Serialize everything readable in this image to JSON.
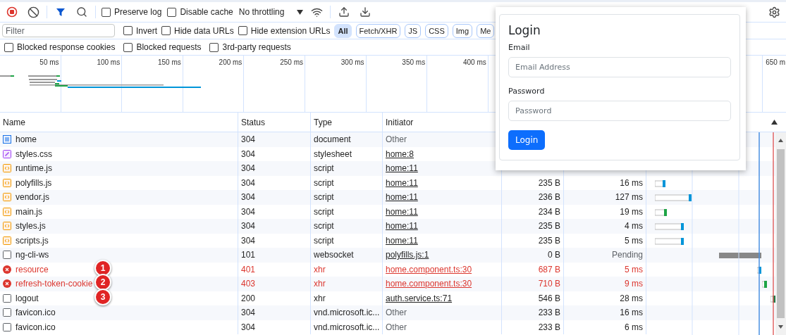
{
  "toolbar": {
    "checkboxes": [
      {
        "label": "Preserve log",
        "checked": false
      },
      {
        "label": "Disable cache",
        "checked": false
      }
    ],
    "throttling": "No throttling"
  },
  "filter_bar": {
    "placeholder": "Filter",
    "checkboxes": [
      {
        "label": "Invert",
        "checked": false
      },
      {
        "label": "Hide data URLs",
        "checked": false
      },
      {
        "label": "Hide extension URLs",
        "checked": false
      }
    ],
    "type_chips": [
      {
        "label": "All",
        "selected": true
      },
      {
        "label": "Fetch/XHR",
        "selected": false
      },
      {
        "label": "JS",
        "selected": false
      },
      {
        "label": "CSS",
        "selected": false
      },
      {
        "label": "Img",
        "selected": false
      },
      {
        "label": "Me",
        "selected": false
      }
    ]
  },
  "options_row": [
    {
      "label": "Blocked response cookies",
      "checked": false
    },
    {
      "label": "Blocked requests",
      "checked": false
    },
    {
      "label": "3rd-party requests",
      "checked": false
    }
  ],
  "overview": {
    "ticks": [
      "50 ms",
      "100 ms",
      "150 ms",
      "200 ms",
      "250 ms",
      "300 ms",
      "350 ms",
      "400 ms",
      "650 m"
    ]
  },
  "table": {
    "columns": [
      "Name",
      "Status",
      "Type",
      "Initiator"
    ],
    "rows": [
      {
        "name": "home",
        "kind": "doc",
        "status": "304",
        "type": "document",
        "initiator": "Other",
        "link": false,
        "error": false
      },
      {
        "name": "styles.css",
        "kind": "css",
        "status": "304",
        "type": "stylesheet",
        "initiator": "home:8",
        "link": true,
        "error": false
      },
      {
        "name": "runtime.js",
        "kind": "js",
        "status": "304",
        "type": "script",
        "initiator": "home:11",
        "link": true,
        "error": false
      },
      {
        "name": "polyfills.js",
        "kind": "js",
        "status": "304",
        "type": "script",
        "initiator": "home:11",
        "link": true,
        "size": "235 B",
        "time": "16 ms",
        "error": false
      },
      {
        "name": "vendor.js",
        "kind": "js",
        "status": "304",
        "type": "script",
        "initiator": "home:11",
        "link": true,
        "size": "236 B",
        "time": "127 ms",
        "error": false
      },
      {
        "name": "main.js",
        "kind": "js",
        "status": "304",
        "type": "script",
        "initiator": "home:11",
        "link": true,
        "size": "234 B",
        "time": "19 ms",
        "error": false
      },
      {
        "name": "styles.js",
        "kind": "js",
        "status": "304",
        "type": "script",
        "initiator": "home:11",
        "link": true,
        "size": "235 B",
        "time": "4 ms",
        "error": false
      },
      {
        "name": "scripts.js",
        "kind": "js",
        "status": "304",
        "type": "script",
        "initiator": "home:11",
        "link": true,
        "size": "235 B",
        "time": "5 ms",
        "error": false
      },
      {
        "name": "ng-cli-ws",
        "kind": "plain",
        "status": "101",
        "type": "websocket",
        "initiator": "polyfills.js:1",
        "link": true,
        "size": "0 B",
        "time": "Pending",
        "error": false
      },
      {
        "name": "resource",
        "kind": "failed",
        "status": "401",
        "type": "xhr",
        "initiator": "home.component.ts:30",
        "link": true,
        "size": "687 B",
        "time": "5 ms",
        "error": true,
        "callout": "1"
      },
      {
        "name": "refresh-token-cookie",
        "kind": "failed",
        "status": "403",
        "type": "xhr",
        "initiator": "home.component.ts:30",
        "link": true,
        "size": "710 B",
        "time": "9 ms",
        "error": true,
        "callout": "2"
      },
      {
        "name": "logout",
        "kind": "plain",
        "status": "200",
        "type": "xhr",
        "initiator": "auth.service.ts:71",
        "link": true,
        "size": "546 B",
        "time": "28 ms",
        "error": false,
        "callout": "3"
      },
      {
        "name": "favicon.ico",
        "kind": "plain",
        "status": "304",
        "type": "vnd.microsoft.ic...",
        "initiator": "Other",
        "link": false,
        "size": "233 B",
        "time": "16 ms",
        "error": false
      },
      {
        "name": "favicon.ico",
        "kind": "plain",
        "status": "304",
        "type": "vnd.microsoft.ic...",
        "initiator": "Other",
        "link": false,
        "size": "233 B",
        "time": "6 ms",
        "error": false
      }
    ]
  },
  "login": {
    "title": "Login",
    "fields": [
      {
        "label": "Email",
        "placeholder": "Email Address"
      },
      {
        "label": "Password",
        "placeholder": "Password"
      }
    ],
    "button": "Login"
  }
}
